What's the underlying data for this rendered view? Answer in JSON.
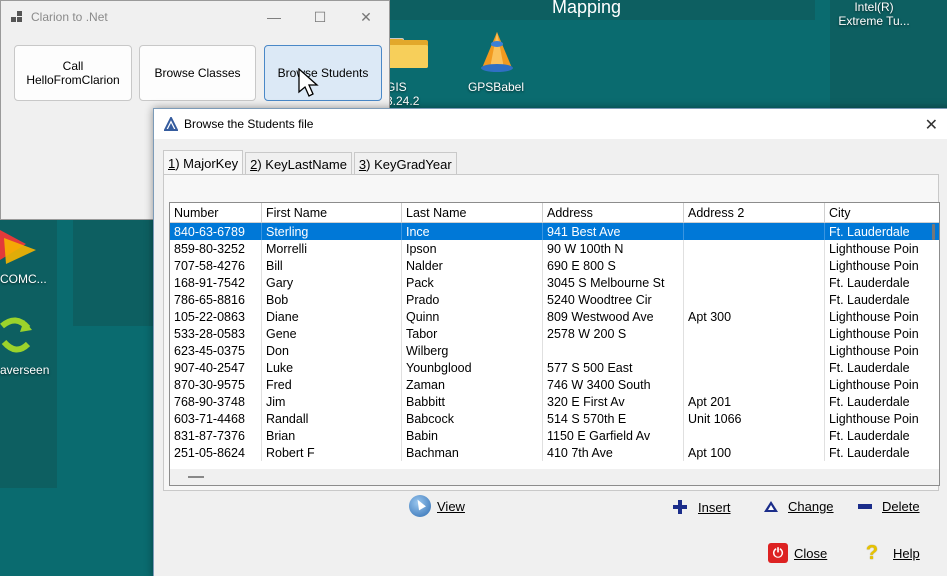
{
  "desktop": {
    "title": "Mapping",
    "icons": [
      {
        "label": "GIS 3.24.2",
        "icon": "folder-icon"
      },
      {
        "label": "GPSBabel",
        "icon": "gpsbabel-icon"
      },
      {
        "label": "Intel(R)\nExtreme Tu...",
        "icon": "intel-icon"
      },
      {
        "label": "COMC...",
        "icon": "app-icon"
      },
      {
        "label": "averseen",
        "icon": "recycle-icon"
      }
    ]
  },
  "clarion_window": {
    "title": "Clarion to .Net",
    "controls": {
      "minimize": "—",
      "maximize": "☐",
      "close": "✕"
    },
    "buttons": [
      {
        "line1": "Call",
        "line2": "HelloFromClarion"
      },
      {
        "label": "Browse Classes"
      },
      {
        "label": "Browse Students"
      }
    ]
  },
  "browse_window": {
    "title": "Browse the Students file",
    "close": "✕",
    "tabs": [
      {
        "prefix": "1",
        "label": ") MajorKey"
      },
      {
        "prefix": "2",
        "label": ") KeyLastName"
      },
      {
        "prefix": "3",
        "label": ") KeyGradYear"
      }
    ],
    "columns": [
      "Number",
      "First Name",
      "Last Name",
      "Address",
      "Address 2",
      "City"
    ],
    "rows": [
      [
        "840-63-6789",
        "Sterling",
        "Ince",
        "941 Best Ave",
        "",
        "Ft. Lauderdale"
      ],
      [
        "859-80-3252",
        "Morrelli",
        "Ipson",
        "90 W 100th N",
        "",
        "Lighthouse Poin"
      ],
      [
        "707-58-4276",
        "Bill",
        "Nalder",
        "690 E 800 S",
        "",
        "Lighthouse Poin"
      ],
      [
        "168-91-7542",
        "Gary",
        "Pack",
        "3045 S Melbourne St",
        "",
        "Ft. Lauderdale"
      ],
      [
        "786-65-8816",
        "Bob",
        "Prado",
        "5240 Woodtree Cir",
        "",
        "Ft. Lauderdale"
      ],
      [
        "105-22-0863",
        "Diane",
        "Quinn",
        "809 Westwood Ave",
        "Apt 300",
        "Lighthouse Poin"
      ],
      [
        "533-28-0583",
        "Gene",
        "Tabor",
        "2578 W 200 S",
        "",
        "Lighthouse Poin"
      ],
      [
        "623-45-0375",
        "Don",
        "Wilberg",
        "",
        "",
        "Lighthouse Poin"
      ],
      [
        "907-40-2547",
        "Luke",
        "Younbglood",
        "577 S 500 East",
        "",
        "Ft. Lauderdale"
      ],
      [
        "870-30-9575",
        "Fred",
        "Zaman",
        "746 W 3400 South",
        "",
        "Lighthouse Poin"
      ],
      [
        "768-90-3748",
        "Jim",
        "Babbitt",
        "320 E First Av",
        "Apt 201",
        "Ft. Lauderdale"
      ],
      [
        "603-71-4468",
        "Randall",
        "Babcock",
        "514 S 570th E",
        "Unit 1066",
        "Lighthouse Poin"
      ],
      [
        "831-87-7376",
        "Brian",
        "Babin",
        "1150 E Garfield Av",
        "",
        "Ft. Lauderdale"
      ],
      [
        "251-05-8624",
        "Robert F",
        "Bachman",
        "410 7th Ave",
        "Apt 100",
        "Ft. Lauderdale"
      ]
    ],
    "actions": {
      "view": "View",
      "insert": "Insert",
      "change": "Change",
      "delete": "Delete",
      "close": "Close",
      "help": "Help"
    }
  }
}
